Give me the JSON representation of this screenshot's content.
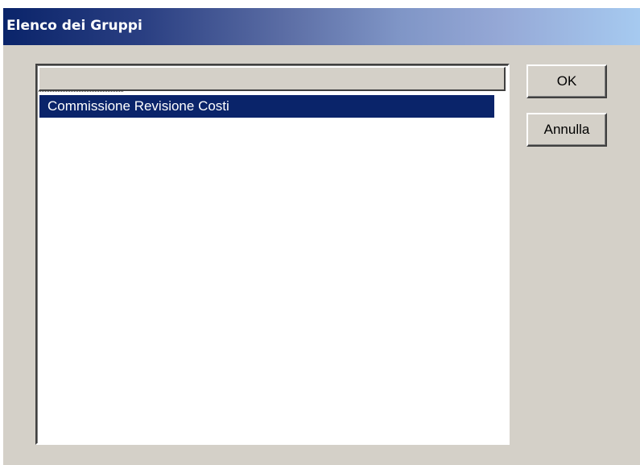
{
  "window": {
    "title": "Elenco dei Gruppi"
  },
  "list": {
    "items": [
      {
        "label": "Commissione Revisione Costi",
        "selected": true
      }
    ]
  },
  "buttons": {
    "ok_label": "OK",
    "cancel_label": "Annulla"
  },
  "colors": {
    "titlebar_start": "#0a246a",
    "titlebar_end": "#a6caf0",
    "selection": "#0a246a",
    "face": "#d4d0c8"
  }
}
